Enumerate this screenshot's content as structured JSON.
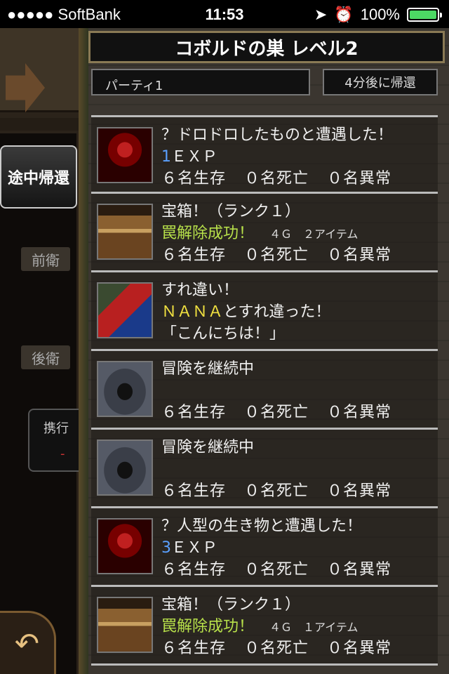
{
  "status_bar": {
    "carrier": "●●●●● SoftBank",
    "time": "11:53",
    "battery": "100%"
  },
  "side": {
    "return_button": "途中帰還",
    "front_label": "前衛",
    "rear_label": "後衛",
    "carry_label": "携行",
    "carry_value": "-"
  },
  "header": {
    "title": "コボルドの巣 レベル2",
    "party": "パーティ1",
    "return_time": "4分後に帰還"
  },
  "logs": [
    {
      "icon": "enemy",
      "line1": "？ドロドロしたものと遭遇した！",
      "exp_num": "1",
      "exp_label": "ＥＸＰ",
      "alive": "６名生存",
      "dead": "０名死亡",
      "abnormal": "０名異常"
    },
    {
      "icon": "chest",
      "line1": "宝箱！（ランク１）",
      "success": "罠解除成功！",
      "loot": "４Ｇ　２アイテム",
      "alive": "６名生存",
      "dead": "０名死亡",
      "abnormal": "０名異常"
    },
    {
      "icon": "knight",
      "line1": "すれ違い！",
      "name": "ＮＡＮＡ",
      "name_suffix": "とすれ違った！",
      "line3": "「こんにちは！」"
    },
    {
      "icon": "corridor",
      "line1": "冒険を継続中",
      "alive": "６名生存",
      "dead": "０名死亡",
      "abnormal": "０名異常"
    },
    {
      "icon": "corridor",
      "line1": "冒険を継続中",
      "alive": "６名生存",
      "dead": "０名死亡",
      "abnormal": "０名異常"
    },
    {
      "icon": "enemy",
      "line1": "？人型の生き物と遭遇した！",
      "exp_num": "3",
      "exp_label": "ＥＸＰ",
      "alive": "６名生存",
      "dead": "０名死亡",
      "abnormal": "０名異常"
    },
    {
      "icon": "chest",
      "line1": "宝箱！（ランク１）",
      "success": "罠解除成功！",
      "loot": "４Ｇ　１アイテム",
      "alive": "６名生存",
      "dead": "０名死亡",
      "abnormal": "０名異常"
    }
  ]
}
